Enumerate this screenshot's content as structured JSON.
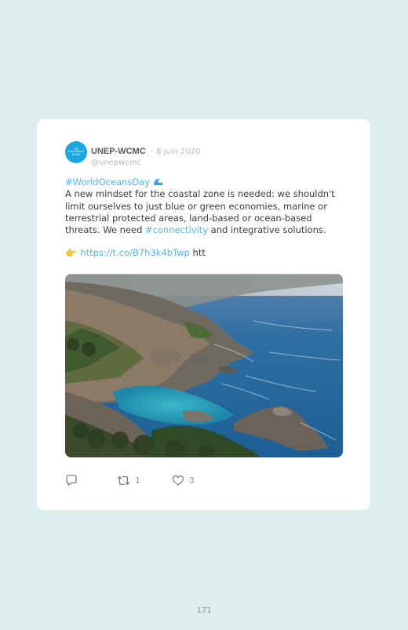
{
  "tweet": {
    "author": {
      "name": "UNEP-WCMC",
      "handle": "@unepwcmc",
      "avatar_text": [
        "UN",
        "environment",
        "WCMC"
      ]
    },
    "separator": "·",
    "date": "8 juin 2020",
    "hashtag_title": "#WorldOceansDay",
    "hashtag_title_icon": "wave-emoji-icon",
    "text_part1": "A new mindset for the coastal zone is needed: we shouldn't limit ourselves to just blue or green economies, marine or terrestrial protected areas, land-based or ocean-based threats. We need ",
    "hashtag_inline": "#connectivity",
    "text_part2": " and integrative solutions.",
    "pointing_icon": "pointing-hand-emoji-icon",
    "link": "https://t.co/B7h3k4bTwp",
    "link_trailing": "htt",
    "image_icon": "coastal-cliffs-photo",
    "actions": {
      "reply": {
        "icon": "reply-icon",
        "count": ""
      },
      "retweet": {
        "icon": "retweet-icon",
        "count": "1"
      },
      "like": {
        "icon": "heart-icon",
        "count": "3"
      }
    }
  },
  "page": {
    "number": "171"
  },
  "colors": {
    "background": "#dcefed",
    "card": "#ffffff",
    "accent": "#4fb6e9",
    "avatar": "#1aa7e0"
  }
}
